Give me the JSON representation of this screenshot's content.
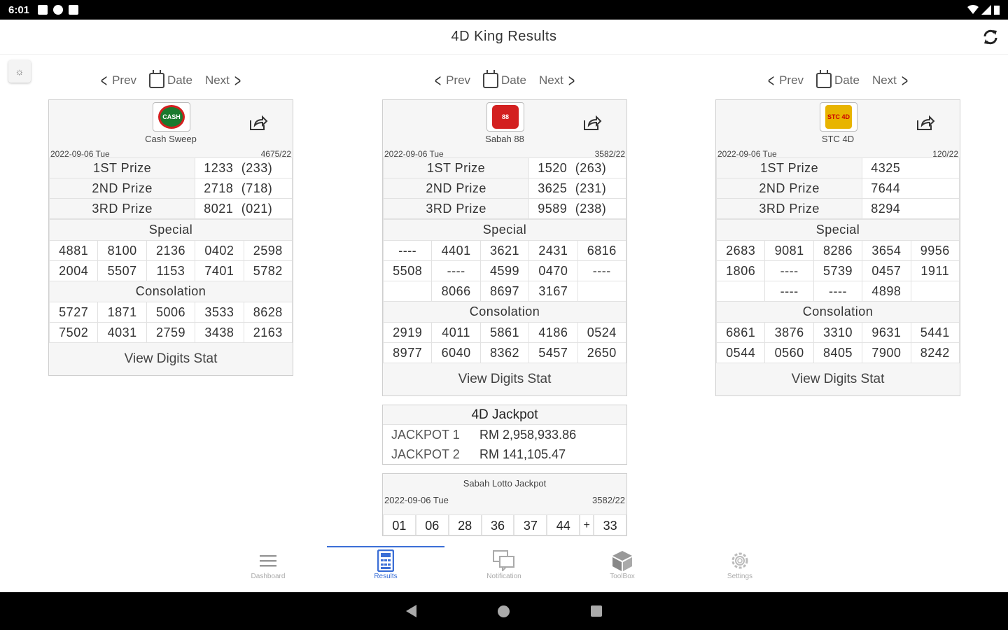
{
  "status_bar": {
    "time": "6:01"
  },
  "app": {
    "title": "4D King Results"
  },
  "nav": {
    "prev": "Prev",
    "date": "Date",
    "next": "Next"
  },
  "results": [
    {
      "name": "Cash Sweep",
      "logo_color": "#1a7a2e",
      "logo_text": "CASH",
      "date": "2022-09-06 Tue",
      "draw_no": "4675/22",
      "prizes": [
        {
          "label": "1ST Prize",
          "value": "1233  (233)"
        },
        {
          "label": "2ND Prize",
          "value": "2718  (718)"
        },
        {
          "label": "3RD Prize",
          "value": "8021  (021)"
        }
      ],
      "special_label": "Special",
      "special": [
        [
          "4881",
          "8100",
          "2136",
          "0402",
          "2598"
        ],
        [
          "2004",
          "5507",
          "1153",
          "7401",
          "5782"
        ]
      ],
      "consolation_label": "Consolation",
      "consolation": [
        [
          "5727",
          "1871",
          "5006",
          "3533",
          "8628"
        ],
        [
          "7502",
          "4031",
          "2759",
          "3438",
          "2163"
        ]
      ],
      "stat_label": "View Digits Stat"
    },
    {
      "name": "Sabah 88",
      "logo_color": "#d32020",
      "logo_text": "88",
      "date": "2022-09-06 Tue",
      "draw_no": "3582/22",
      "prizes": [
        {
          "label": "1ST Prize",
          "value": "1520  (263)"
        },
        {
          "label": "2ND Prize",
          "value": "3625  (231)"
        },
        {
          "label": "3RD Prize",
          "value": "9589  (238)"
        }
      ],
      "special_label": "Special",
      "special": [
        [
          "----",
          "4401",
          "3621",
          "2431",
          "6816"
        ],
        [
          "5508",
          "----",
          "4599",
          "0470",
          "----"
        ],
        [
          "",
          "8066",
          "8697",
          "3167",
          ""
        ]
      ],
      "consolation_label": "Consolation",
      "consolation": [
        [
          "2919",
          "4011",
          "5861",
          "4186",
          "0524"
        ],
        [
          "8977",
          "6040",
          "8362",
          "5457",
          "2650"
        ]
      ],
      "stat_label": "View Digits Stat"
    },
    {
      "name": "STC 4D",
      "logo_color": "#e8b400",
      "logo_text": "STC 4D",
      "date": "2022-09-06 Tue",
      "draw_no": "120/22",
      "prizes": [
        {
          "label": "1ST Prize",
          "value": "4325"
        },
        {
          "label": "2ND Prize",
          "value": "7644"
        },
        {
          "label": "3RD Prize",
          "value": "8294"
        }
      ],
      "special_label": "Special",
      "special": [
        [
          "2683",
          "9081",
          "8286",
          "3654",
          "9956"
        ],
        [
          "1806",
          "----",
          "5739",
          "0457",
          "1911"
        ],
        [
          "",
          "----",
          "----",
          "4898",
          ""
        ]
      ],
      "consolation_label": "Consolation",
      "consolation": [
        [
          "6861",
          "3876",
          "3310",
          "9631",
          "5441"
        ],
        [
          "0544",
          "0560",
          "8405",
          "7900",
          "8242"
        ]
      ],
      "stat_label": "View Digits Stat"
    }
  ],
  "jackpot": {
    "title": "4D Jackpot",
    "rows": [
      {
        "label": "JACKPOT 1",
        "value": "RM 2,958,933.86"
      },
      {
        "label": "JACKPOT 2",
        "value": "RM 141,105.47"
      }
    ]
  },
  "lotto": {
    "title": "Sabah Lotto Jackpot",
    "date": "2022-09-06 Tue",
    "draw_no": "3582/22",
    "numbers": [
      "01",
      "06",
      "28",
      "36",
      "37",
      "44"
    ],
    "plus": "+",
    "bonus": "33"
  },
  "bottom_nav": [
    {
      "label": "Dashboard",
      "icon": "menu-icon",
      "active": false
    },
    {
      "label": "Results",
      "icon": "calculator-icon",
      "active": true
    },
    {
      "label": "Notification",
      "icon": "chat-icon",
      "active": false
    },
    {
      "label": "ToolBox",
      "icon": "box-icon",
      "active": false
    },
    {
      "label": "Settings",
      "icon": "gear-icon",
      "active": false
    }
  ],
  "colors": {
    "accent": "#3b6fd6"
  }
}
